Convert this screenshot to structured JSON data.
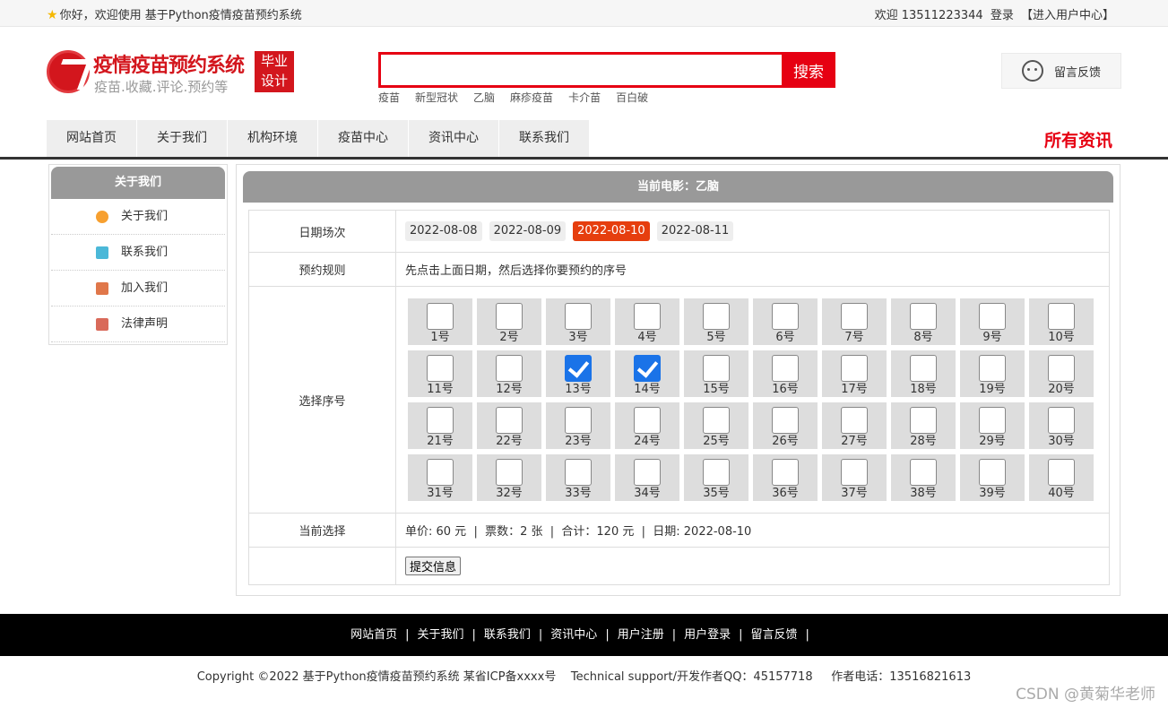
{
  "topbar": {
    "welcome": "你好，欢迎使用 基于Python疫情疫苗预约系统",
    "user_greeting": "欢迎 13511223344",
    "login": "登录",
    "user_center": "【进入用户中心】"
  },
  "logo": {
    "title": "疫情疫苗预约系统",
    "subtitle": "疫苗.收藏.评论.预约等",
    "badge_line1": "毕业",
    "badge_line2": "设计"
  },
  "search": {
    "value": "",
    "button": "搜索",
    "hotwords": [
      "疫苗",
      "新型冠状",
      "乙脑",
      "麻疹疫苗",
      "卡介苗",
      "百白破"
    ]
  },
  "feedback": {
    "label": "留言反馈"
  },
  "nav": {
    "items": [
      "网站首页",
      "关于我们",
      "机构环境",
      "疫苗中心",
      "资讯中心",
      "联系我们"
    ],
    "right": "所有资讯"
  },
  "sidebar": {
    "title": "关于我们",
    "items": [
      {
        "label": "关于我们",
        "icon": "orange-circle-icon",
        "color": "#f7a030"
      },
      {
        "label": "联系我们",
        "icon": "clipboard-icon",
        "color": "#4bb8d8"
      },
      {
        "label": "加入我们",
        "icon": "lock-icon",
        "color": "#e0774a"
      },
      {
        "label": "法律声明",
        "icon": "power-icon",
        "color": "#d96a5a"
      }
    ]
  },
  "main": {
    "heading": "当前电影：乙脑",
    "date_label": "日期场次",
    "dates": [
      "2022-08-08",
      "2022-08-09",
      "2022-08-10",
      "2022-08-11"
    ],
    "active_date": "2022-08-10",
    "rule_label": "预约规则",
    "rule_text": "先点击上面日期，然后选择你要预约的序号",
    "seat_label": "选择序号",
    "seats": [
      "1号",
      "2号",
      "3号",
      "4号",
      "5号",
      "6号",
      "7号",
      "8号",
      "9号",
      "10号",
      "11号",
      "12号",
      "13号",
      "14号",
      "15号",
      "16号",
      "17号",
      "18号",
      "19号",
      "20号",
      "21号",
      "22号",
      "23号",
      "24号",
      "25号",
      "26号",
      "27号",
      "28号",
      "29号",
      "30号",
      "31号",
      "32号",
      "33号",
      "34号",
      "35号",
      "36号",
      "37号",
      "38号",
      "39号",
      "40号"
    ],
    "checked_seats": [
      "13号",
      "14号"
    ],
    "current_label": "当前选择",
    "current_text": "单价: 60 元  |  票数：2 张  |  合计：120 元  |  日期: 2022-08-10",
    "submit": "提交信息"
  },
  "footer": {
    "links": [
      "网站首页",
      "关于我们",
      "联系我们",
      "资讯中心",
      "用户注册",
      "用户登录",
      "留言反馈"
    ],
    "copyright": "Copyright ©2022 基于Python疫情疫苗预约系统 某省ICP备xxxx号    Technical support/开发作者QQ：45157718     作者电话：13516821613",
    "watermark": "CSDN @黄菊华老师"
  },
  "colors": {
    "brand_red": "#d3161d",
    "search_red": "#e60012",
    "active_date": "#e63e0e",
    "check_blue": "#1a73e8"
  }
}
